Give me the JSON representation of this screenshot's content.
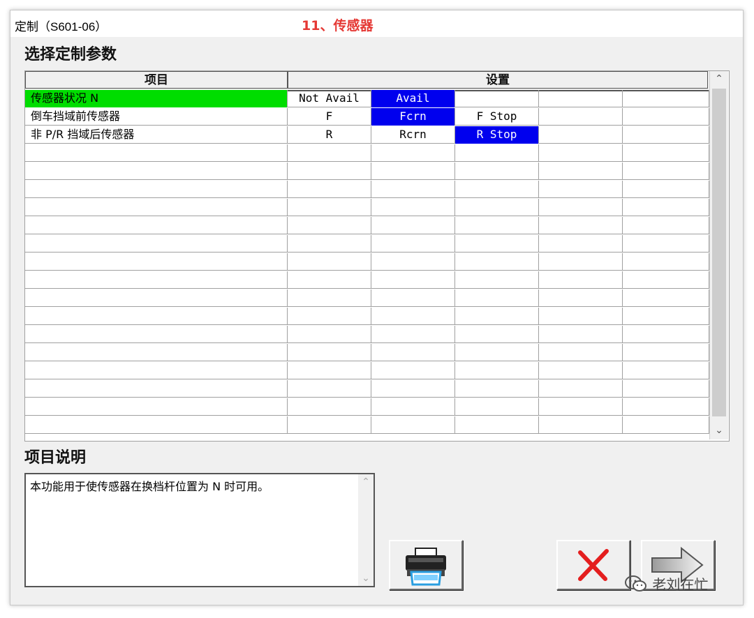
{
  "window": {
    "title": "定制（S601-06）",
    "annotation": "11、传感器"
  },
  "section_heading": "选择定制参数",
  "grid": {
    "headers": {
      "item": "项目",
      "setting": "设置"
    },
    "rows": [
      {
        "item": "传感器状况 N",
        "options": [
          "Not Avail",
          "Avail",
          "",
          "",
          ""
        ],
        "selected": 1,
        "item_highlight": true
      },
      {
        "item": "倒车挡域前传感器",
        "options": [
          "F",
          "Fcrn",
          "F Stop",
          "",
          ""
        ],
        "selected": 1,
        "item_highlight": false
      },
      {
        "item": "非 P/R 挡域后传感器",
        "options": [
          "R",
          "Rcrn",
          "R Stop",
          "",
          ""
        ],
        "selected": 2,
        "item_highlight": false
      }
    ],
    "empty_rows": 16,
    "colors": {
      "item_highlight": "#00dd00",
      "selected": "#0000ee"
    }
  },
  "description": {
    "heading": "项目说明",
    "text": "本功能用于使传感器在换档杆位置为 N 时可用。"
  },
  "buttons": {
    "print_icon": "printer-icon",
    "cancel_icon": "red-x-icon",
    "next_icon": "arrow-right-icon"
  },
  "watermark": "老刘在忙"
}
